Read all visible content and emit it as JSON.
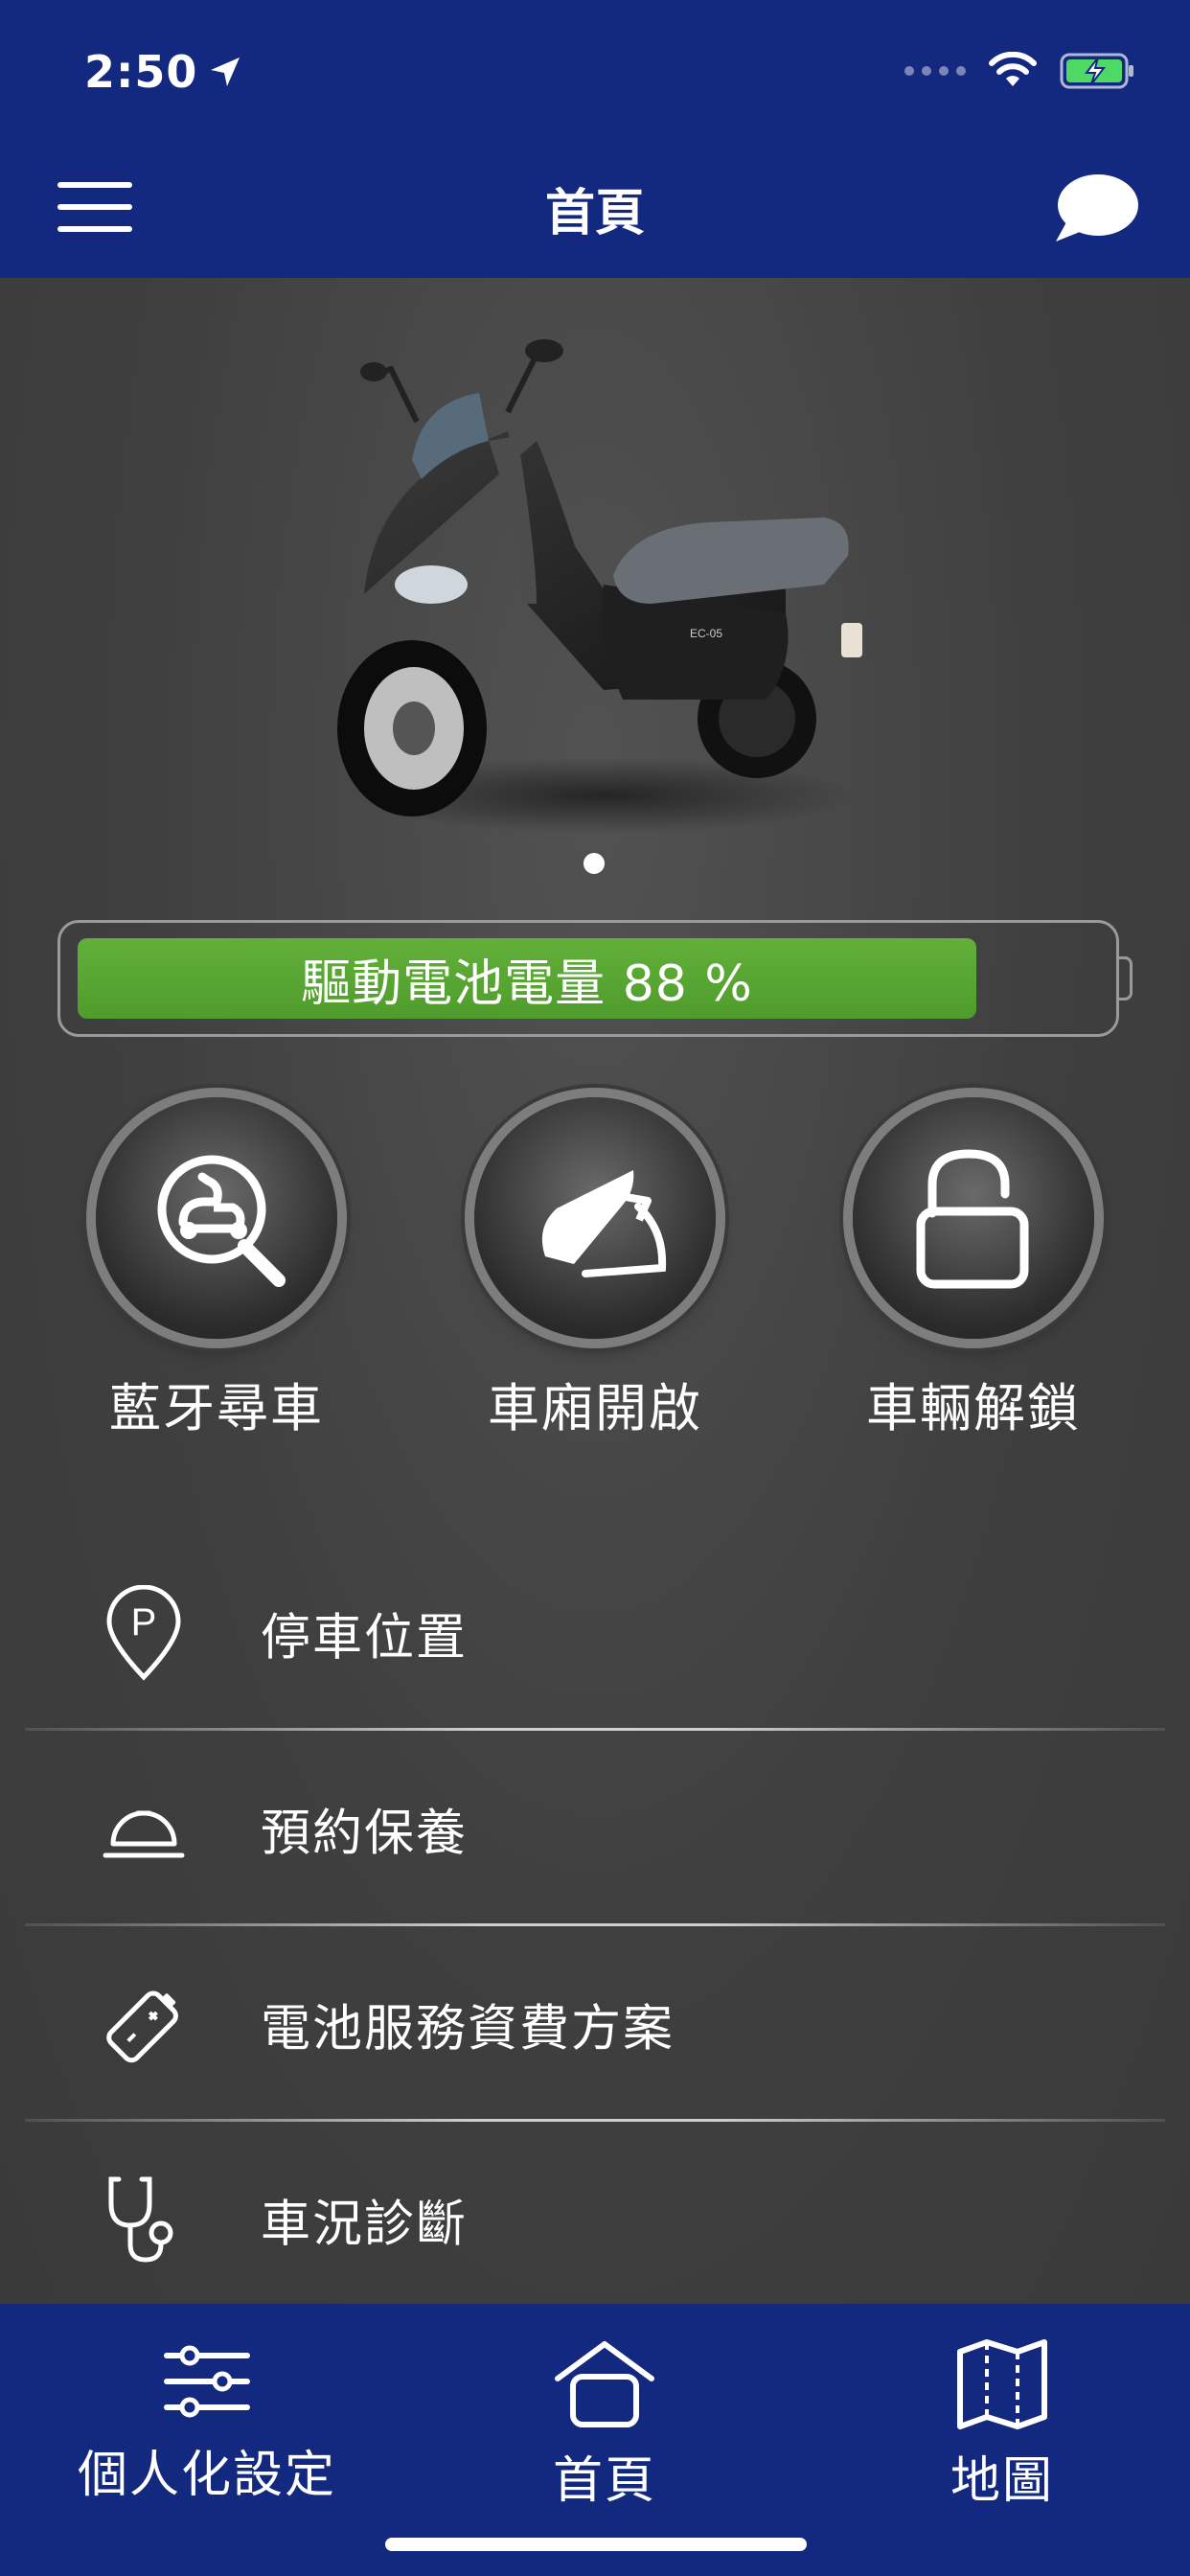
{
  "status_bar": {
    "time": "2:50"
  },
  "header": {
    "title": "首頁"
  },
  "battery": {
    "label": "驅動電池電量 88 %",
    "level": 0.88,
    "fill_color": "#5aa532"
  },
  "carousel": {
    "pages": 1,
    "active": 0
  },
  "actions": [
    {
      "label": "藍牙尋車",
      "icon": "scooter-search-icon"
    },
    {
      "label": "車廂開啟",
      "icon": "seat-open-icon"
    },
    {
      "label": "車輛解鎖",
      "icon": "unlock-icon"
    }
  ],
  "menu": [
    {
      "label": "停車位置",
      "icon": "parking-pin-icon"
    },
    {
      "label": "預約保養",
      "icon": "service-bell-icon"
    },
    {
      "label": "電池服務資費方案",
      "icon": "battery-icon"
    },
    {
      "label": "車況診斷",
      "icon": "stethoscope-icon"
    }
  ],
  "tabbar": [
    {
      "label": "個人化設定",
      "icon": "sliders-icon"
    },
    {
      "label": "首頁",
      "icon": "home-icon"
    },
    {
      "label": "地圖",
      "icon": "map-icon"
    }
  ],
  "colors": {
    "brand": "#13287f",
    "background": "#3d3d3d",
    "battery": "#5aa532"
  }
}
